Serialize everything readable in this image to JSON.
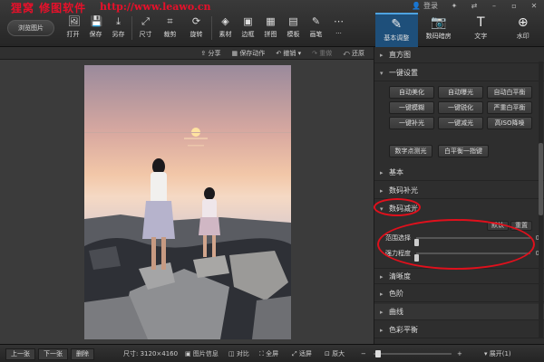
{
  "watermark": {
    "cn": "狸窝 修图软件",
    "url": "http://www.leawo.cn"
  },
  "titlebar": {
    "login": "登录",
    "icons": [
      "shirt-icon",
      "share-icon",
      "minimize-icon",
      "restore-icon",
      "close-icon"
    ]
  },
  "toolbar": {
    "browse_label": "浏览图片",
    "tools": [
      {
        "label": "打开",
        "icon": "open-icon",
        "glyph": "🖼"
      },
      {
        "label": "保存",
        "icon": "save-icon",
        "glyph": "💾"
      },
      {
        "label": "另存",
        "icon": "save-as-icon",
        "glyph": "⤓"
      },
      {
        "label": "尺寸",
        "icon": "resize-icon",
        "glyph": "⤢"
      },
      {
        "label": "裁剪",
        "icon": "crop-icon",
        "glyph": "⌗"
      },
      {
        "label": "旋转",
        "icon": "rotate-icon",
        "glyph": "⟳"
      },
      {
        "label": "素材",
        "icon": "material-icon",
        "glyph": "◈"
      },
      {
        "label": "边框",
        "icon": "frame-icon",
        "glyph": "▣"
      },
      {
        "label": "拼图",
        "icon": "collage-icon",
        "glyph": "▦"
      },
      {
        "label": "模板",
        "icon": "template-icon",
        "glyph": "▤"
      },
      {
        "label": "画笔",
        "icon": "brush-icon",
        "glyph": "✎"
      },
      {
        "label": "···",
        "icon": "more-icon",
        "glyph": "⋯"
      }
    ]
  },
  "right_tabs": [
    {
      "label": "基本调整",
      "icon": "adjust-icon",
      "glyph": "✎",
      "active": true
    },
    {
      "label": "数码暗房",
      "icon": "camera-icon",
      "glyph": "📷",
      "active": false
    },
    {
      "label": "文字",
      "icon": "text-icon",
      "glyph": "T",
      "active": false
    },
    {
      "label": "水印",
      "icon": "watermark-icon",
      "glyph": "⊕",
      "active": false
    }
  ],
  "actionbar": {
    "share": "分享",
    "save_action": "保存动作",
    "undo": "撤销",
    "redo": "重做",
    "restore": "还原"
  },
  "panel": {
    "histogram": "直方图",
    "one_click": "一键设置",
    "one_click_buttons": [
      "自动美化",
      "自动曝光",
      "自动白平衡",
      "一键模糊",
      "一键锐化",
      "严重白平衡",
      "一键补光",
      "一键减光",
      "高ISO降噪"
    ],
    "extra_buttons": [
      "数字点测光",
      "白平衡一指键"
    ],
    "basic": "基本",
    "fill_light": "数码补光",
    "reduce_light": "数码减光",
    "default_btn": "默认",
    "reset_btn": "重置",
    "slider_range": {
      "label": "范围选择",
      "value": "0"
    },
    "slider_strength": {
      "label": "强力程度",
      "value": "0"
    },
    "clarity": "清晰度",
    "levels": "色阶",
    "curves": "曲线",
    "color_balance": "色彩平衡"
  },
  "bottombar": {
    "prev": "上一张",
    "next": "下一张",
    "delete": "删除",
    "size": "尺寸: 3120×4160",
    "info": "图片信息",
    "compare": "对比",
    "fullscreen": "全屏",
    "fit": "适屏",
    "original": "原大",
    "expand": "展开(1)"
  },
  "colors": {
    "accent": "#4fa3e0",
    "active_tab": "#1e4f7a",
    "annotation": "#e0101c"
  }
}
